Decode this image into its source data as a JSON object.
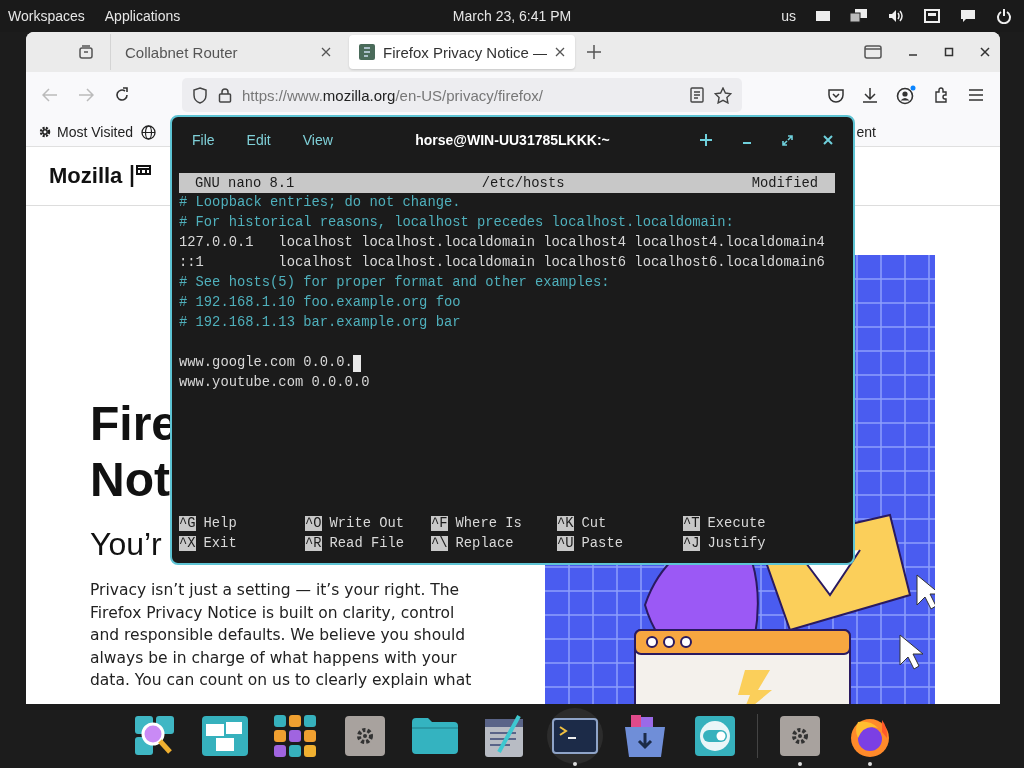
{
  "top_bar": {
    "menus": [
      "Workspaces",
      "Applications"
    ],
    "clock": "March 23, 6:41 PM",
    "keyboard_layout": "us"
  },
  "browser": {
    "tabs": [
      {
        "title": "Collabnet Router",
        "selected": false
      },
      {
        "title": "Firefox Privacy Notice —",
        "selected": true
      }
    ],
    "url": {
      "prefix": "https://www.",
      "domain": "mozilla.org",
      "path": "/en-US/privacy/firefox/"
    },
    "back_disabled": true,
    "forward_disabled": true,
    "bookmarks": [
      {
        "kind": "gear",
        "label": "Most Visited"
      },
      {
        "kind": "globe"
      },
      {
        "kind": "text",
        "label": "ent"
      }
    ],
    "page": {
      "logo": "Mozilla",
      "heading_lines": [
        "Fire",
        "Not"
      ],
      "subheading": "You’r",
      "paragraph": "Privacy isn’t just a setting — it’s your right. The Firefox Privacy Notice is built on clarity, control and responsible defaults. We believe you should always be in charge of what happens with your data. You can count on us to clearly explain what"
    }
  },
  "terminal": {
    "menus": [
      "File",
      "Edit",
      "View"
    ],
    "title": "horse@WIN-UU31785LKKK:~",
    "nano": {
      "app": "GNU nano 8.1",
      "file": "/etc/hosts",
      "status": "Modified"
    },
    "lines": [
      {
        "kind": "comment",
        "text": "# Loopback entries; do not change.",
        "cursor": false
      },
      {
        "kind": "comment",
        "text": "# For historical reasons, localhost precedes localhost.localdomain:",
        "cursor": false
      },
      {
        "kind": "text",
        "text": "127.0.0.1   localhost localhost.localdomain localhost4 localhost4.localdomain4",
        "cursor": false
      },
      {
        "kind": "text",
        "text": "::1         localhost localhost.localdomain localhost6 localhost6.localdomain6",
        "cursor": false
      },
      {
        "kind": "comment",
        "text": "# See hosts(5) for proper format and other examples:",
        "cursor": false
      },
      {
        "kind": "comment",
        "text": "# 192.168.1.10 foo.example.org foo",
        "cursor": false
      },
      {
        "kind": "comment",
        "text": "# 192.168.1.13 bar.example.org bar",
        "cursor": false
      },
      {
        "kind": "blank",
        "cursor": false
      },
      {
        "kind": "text",
        "text": "www.google.com 0.0.0.",
        "cursor": true
      },
      {
        "kind": "text",
        "text": "www.youtube.com 0.0.0.0",
        "cursor": false
      }
    ],
    "shortcuts": [
      [
        {
          "key": "^G",
          "label": "Help"
        },
        {
          "key": "^O",
          "label": "Write Out"
        },
        {
          "key": "^F",
          "label": "Where Is"
        },
        {
          "key": "^K",
          "label": "Cut"
        },
        {
          "key": "^T",
          "label": "Execute"
        }
      ],
      [
        {
          "key": "^X",
          "label": "Exit"
        },
        {
          "key": "^R",
          "label": "Read File"
        },
        {
          "key": "^\\",
          "label": "Replace"
        },
        {
          "key": "^U",
          "label": "Paste"
        },
        {
          "key": "^J",
          "label": "Justify"
        }
      ]
    ]
  },
  "dock": {
    "apps": [
      {
        "kind": "search",
        "running": false,
        "focused": false
      },
      {
        "kind": "windows",
        "running": false,
        "focused": false
      },
      {
        "kind": "grid",
        "running": false,
        "focused": false
      },
      {
        "kind": "settings",
        "running": false,
        "focused": false
      },
      {
        "kind": "folder",
        "running": false,
        "focused": false
      },
      {
        "kind": "editor",
        "running": false,
        "focused": false
      },
      {
        "kind": "terminal",
        "running": true,
        "focused": true
      },
      {
        "kind": "store",
        "running": false,
        "focused": false
      },
      {
        "kind": "toggle",
        "running": false,
        "focused": false
      },
      {
        "kind": "divider"
      },
      {
        "kind": "settings",
        "running": true,
        "focused": false
      },
      {
        "kind": "browser",
        "running": true,
        "focused": false
      }
    ]
  }
}
